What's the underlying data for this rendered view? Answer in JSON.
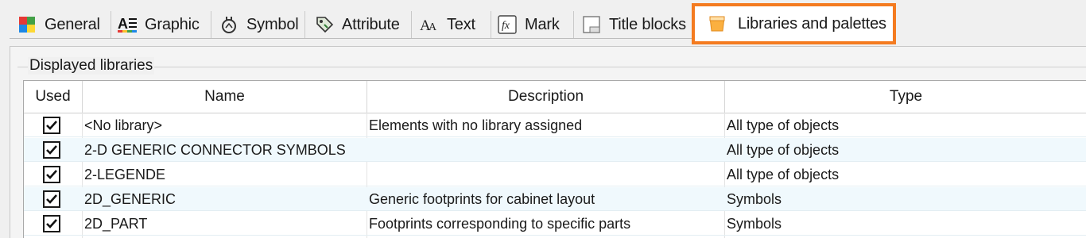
{
  "tabs": [
    {
      "label": "General",
      "icon": "general-icon"
    },
    {
      "label": "Graphic",
      "icon": "graphic-icon"
    },
    {
      "label": "Symbol",
      "icon": "symbol-icon"
    },
    {
      "label": "Attribute",
      "icon": "attribute-icon"
    },
    {
      "label": "Text",
      "icon": "text-icon"
    },
    {
      "label": "Mark",
      "icon": "mark-icon"
    },
    {
      "label": "Title blocks",
      "icon": "title-blocks-icon"
    },
    {
      "label": "Libraries and palettes",
      "icon": "libraries-icon",
      "selected": true
    }
  ],
  "group": {
    "title": "Displayed libraries"
  },
  "grid": {
    "columns": {
      "used": "Used",
      "name": "Name",
      "description": "Description",
      "type": "Type"
    },
    "rows": [
      {
        "used": true,
        "name": "<No library>",
        "description": "Elements with no library assigned",
        "type": "All type of objects"
      },
      {
        "used": true,
        "name": "2-D GENERIC CONNECTOR SYMBOLS",
        "description": "",
        "type": "All type of objects"
      },
      {
        "used": true,
        "name": "2-LEGENDE",
        "description": "",
        "type": "All type of objects"
      },
      {
        "used": true,
        "name": "2D_GENERIC",
        "description": "Generic footprints for cabinet layout",
        "type": "Symbols"
      },
      {
        "used": true,
        "name": "2D_PART",
        "description": "Footprints corresponding to specific parts",
        "type": "Symbols"
      }
    ]
  },
  "colors": {
    "highlight": "#f47b20",
    "row_alt": "#f0f9fd"
  }
}
